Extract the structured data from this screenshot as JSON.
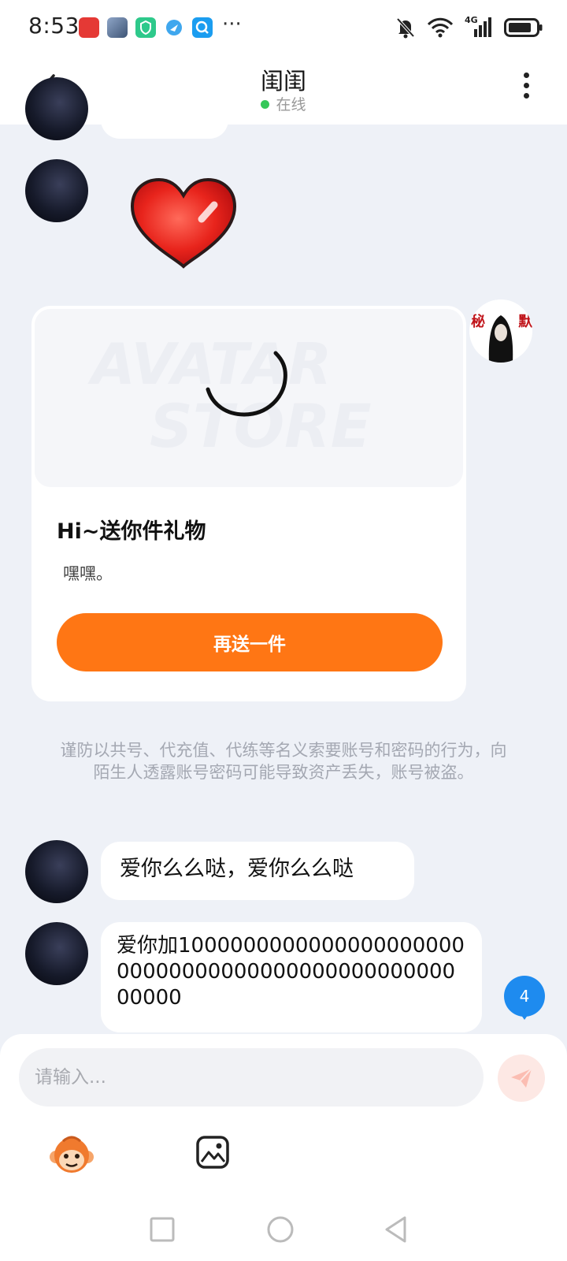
{
  "status_bar": {
    "time": "8:53",
    "app_icons": [
      {
        "name": "huawei-icon",
        "color": "#e53935"
      },
      {
        "name": "game-icon",
        "color": "#5f7fa8"
      },
      {
        "name": "shield-icon",
        "color": "#2ec98b"
      },
      {
        "name": "compass-icon",
        "color": "#3fa7ee"
      },
      {
        "name": "search-app-icon",
        "color": "#1b9df0"
      }
    ],
    "more_indicator": "···",
    "network_label": "4G"
  },
  "header": {
    "title": "闺闺",
    "status": "在线"
  },
  "gift_card": {
    "watermark_line1": "AVATAR",
    "watermark_line2": "STORE",
    "title": "Hi~送你件礼物",
    "description": "嘿嘿。",
    "button_label": "再送一件"
  },
  "self_avatar_text": "秘 默",
  "warning_text": "谨防以共号、代充值、代练等名义索要账号和密码的行为，向陌生人透露账号密码可能导致资产丢失，账号被盗。",
  "messages": [
    {
      "text": "爱你么么哒，爱你么么哒"
    },
    {
      "text": "爱你加10000000000000000000000000000000000000000000000000000"
    }
  ],
  "unread_count": "4",
  "input": {
    "placeholder": "请输入..."
  },
  "colors": {
    "accent": "#ff7614",
    "badge": "#1e8bef",
    "online": "#35c759"
  }
}
